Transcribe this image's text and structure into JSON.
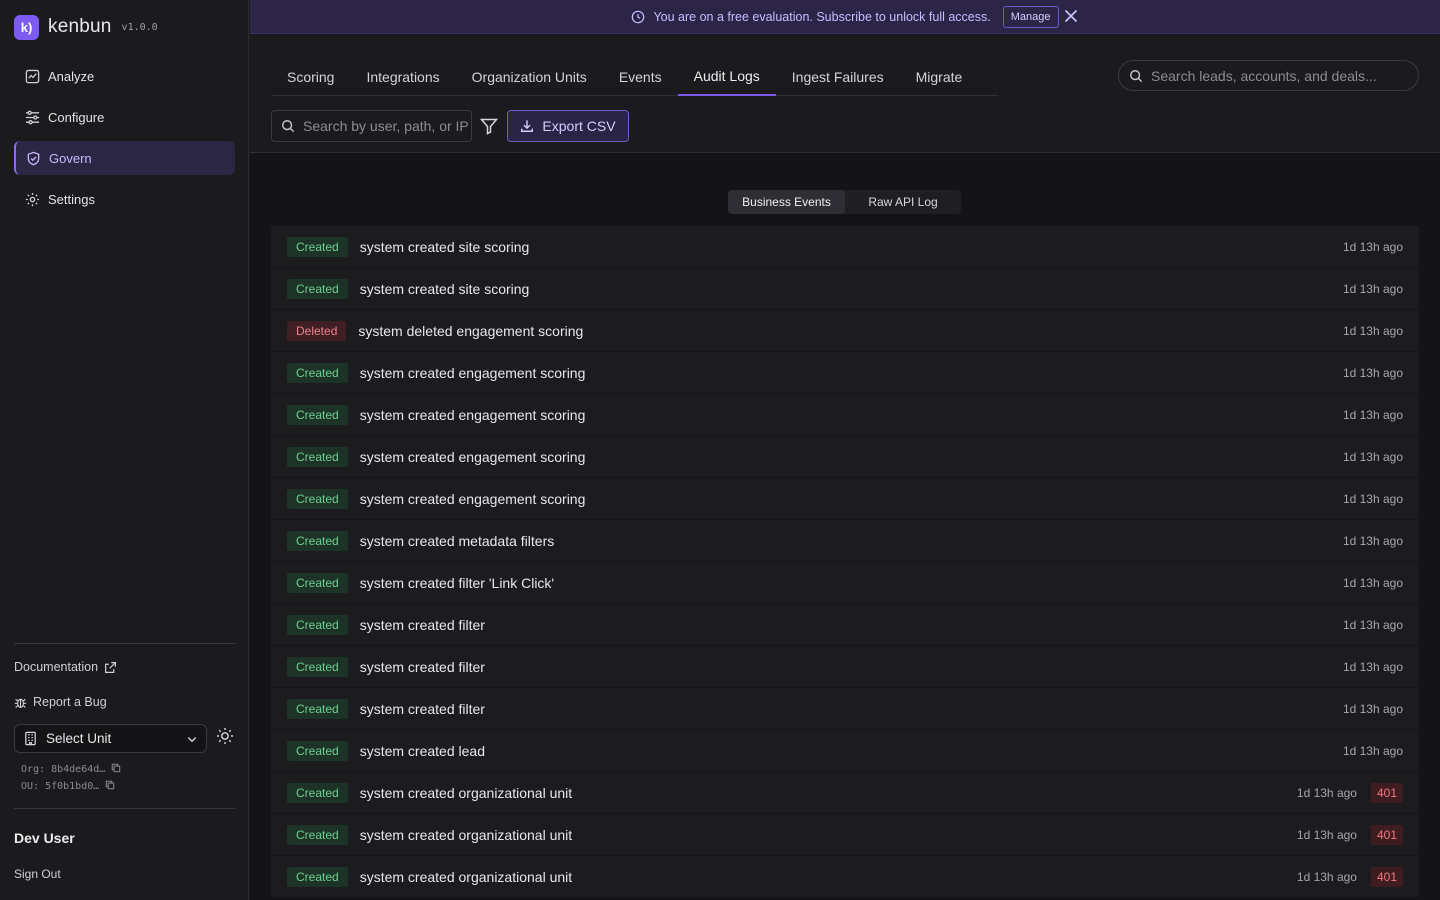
{
  "app": {
    "name": "kenbun",
    "logo_glyph": "k)",
    "version": "v1.0.0"
  },
  "sidebar": {
    "items": [
      {
        "label": "Analyze",
        "icon": "analyze-icon"
      },
      {
        "label": "Configure",
        "icon": "sliders-icon"
      },
      {
        "label": "Govern",
        "icon": "shield-icon",
        "active": true
      },
      {
        "label": "Settings",
        "icon": "gear-icon"
      }
    ],
    "documentation": "Documentation",
    "report_bug": "Report a Bug",
    "select_unit": "Select Unit",
    "org_id": "Org: 8b4de64d…",
    "ou_id": "OU: 5f0b1bd0…",
    "user_name": "Dev User",
    "sign_out": "Sign Out"
  },
  "banner": {
    "message": "You are on a free evaluation. Subscribe to unlock full access.",
    "manage_label": "Manage"
  },
  "tabs": [
    "Scoring",
    "Integrations",
    "Organization Units",
    "Events",
    "Audit Logs",
    "Ingest Failures",
    "Migrate"
  ],
  "active_tab": "Audit Logs",
  "global_search": {
    "placeholder": "Search leads, accounts, and deals..."
  },
  "audit_search": {
    "placeholder": "Search by user, path, or IP"
  },
  "export_label": "Export CSV",
  "view_toggle": {
    "options": [
      "Business Events",
      "Raw API Log"
    ],
    "selected": "Business Events"
  },
  "logs": [
    {
      "action": "Created",
      "text": "system created site scoring",
      "time": "1d 13h ago",
      "status": ""
    },
    {
      "action": "Created",
      "text": "system created site scoring",
      "time": "1d 13h ago",
      "status": ""
    },
    {
      "action": "Deleted",
      "text": "system deleted engagement scoring",
      "time": "1d 13h ago",
      "status": ""
    },
    {
      "action": "Created",
      "text": "system created engagement scoring",
      "time": "1d 13h ago",
      "status": ""
    },
    {
      "action": "Created",
      "text": "system created engagement scoring",
      "time": "1d 13h ago",
      "status": ""
    },
    {
      "action": "Created",
      "text": "system created engagement scoring",
      "time": "1d 13h ago",
      "status": ""
    },
    {
      "action": "Created",
      "text": "system created engagement scoring",
      "time": "1d 13h ago",
      "status": ""
    },
    {
      "action": "Created",
      "text": "system created metadata filters",
      "time": "1d 13h ago",
      "status": ""
    },
    {
      "action": "Created",
      "text": "system created filter 'Link Click'",
      "time": "1d 13h ago",
      "status": ""
    },
    {
      "action": "Created",
      "text": "system created filter",
      "time": "1d 13h ago",
      "status": ""
    },
    {
      "action": "Created",
      "text": "system created filter",
      "time": "1d 13h ago",
      "status": ""
    },
    {
      "action": "Created",
      "text": "system created filter",
      "time": "1d 13h ago",
      "status": ""
    },
    {
      "action": "Created",
      "text": "system created lead",
      "time": "1d 13h ago",
      "status": ""
    },
    {
      "action": "Created",
      "text": "system created organizational unit",
      "time": "1d 13h ago",
      "status": "401"
    },
    {
      "action": "Created",
      "text": "system created organizational unit",
      "time": "1d 13h ago",
      "status": "401"
    },
    {
      "action": "Created",
      "text": "system created organizational unit",
      "time": "1d 13h ago",
      "status": "401"
    }
  ],
  "colors": {
    "accent": "#7c5cf0",
    "created": "#6fcf8f",
    "deleted": "#f08088",
    "error": "#ee7a80"
  }
}
